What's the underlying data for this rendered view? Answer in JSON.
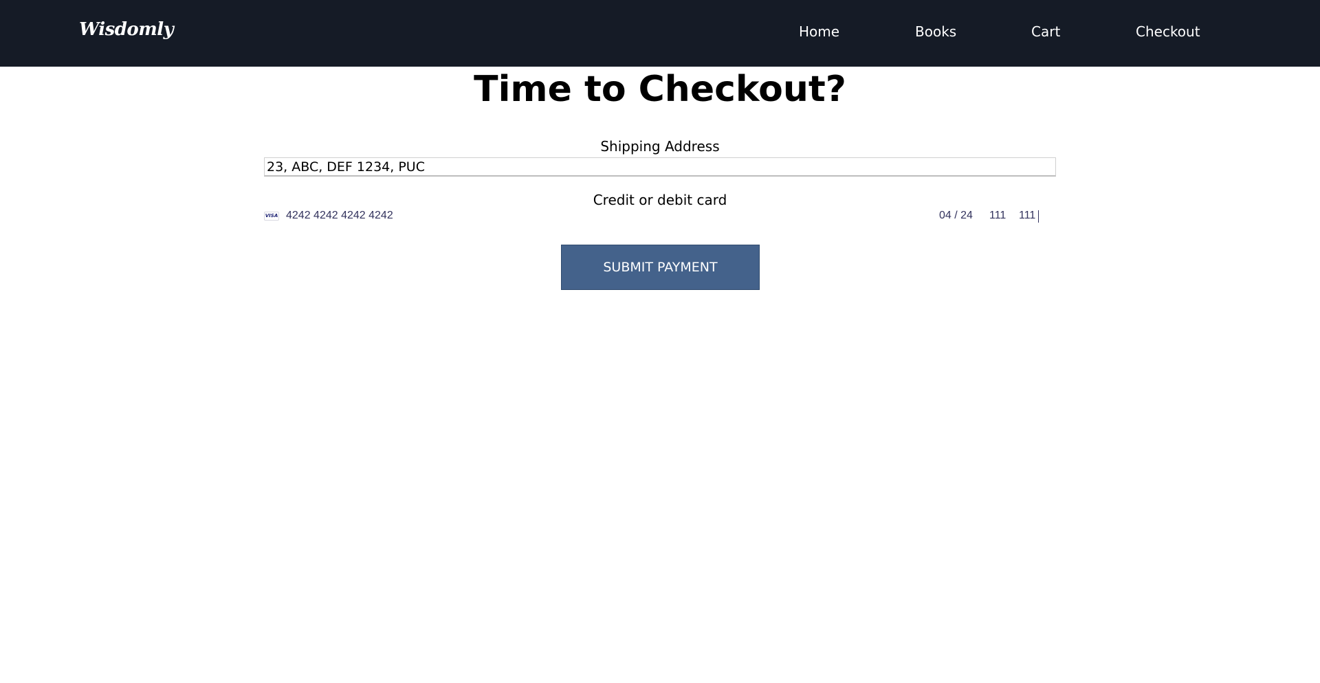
{
  "navbar": {
    "logo": "Wisdomly",
    "links": [
      "Home",
      "Books",
      "Cart",
      "Checkout"
    ]
  },
  "main": {
    "title": "Time to Checkout?",
    "shipping": {
      "label": "Shipping Address",
      "value": "23, ABC, DEF 1234, PUC"
    },
    "card": {
      "label": "Credit or debit card",
      "brand_icon": "visa-icon",
      "brand_text": "VISA",
      "number": "4242 4242 4242 4242",
      "expiry": "04 / 24",
      "cvc": "111",
      "zip": "111"
    },
    "submit_label": "SUBMIT PAYMENT"
  },
  "colors": {
    "navbar_bg": "#151b26",
    "button_bg": "#44628b",
    "card_text": "#32325d"
  }
}
